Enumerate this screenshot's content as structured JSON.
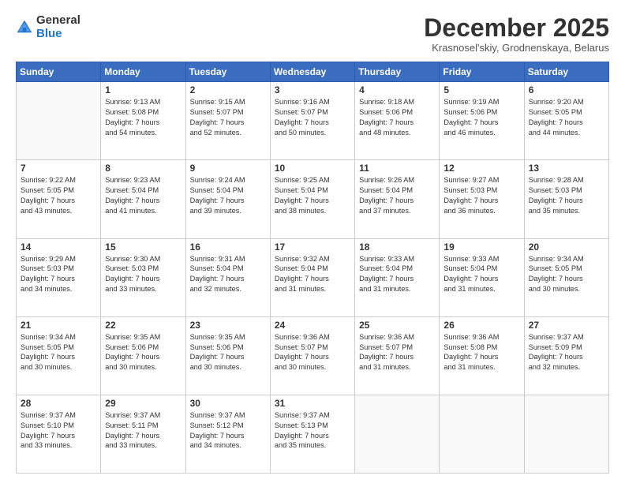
{
  "logo": {
    "general": "General",
    "blue": "Blue"
  },
  "header": {
    "month": "December 2025",
    "location": "Krasnosel'skiy, Grodnenskaya, Belarus"
  },
  "days": [
    "Sunday",
    "Monday",
    "Tuesday",
    "Wednesday",
    "Thursday",
    "Friday",
    "Saturday"
  ],
  "weeks": [
    [
      {
        "day": "",
        "info": ""
      },
      {
        "day": "1",
        "info": "Sunrise: 9:13 AM\nSunset: 5:08 PM\nDaylight: 7 hours\nand 54 minutes."
      },
      {
        "day": "2",
        "info": "Sunrise: 9:15 AM\nSunset: 5:07 PM\nDaylight: 7 hours\nand 52 minutes."
      },
      {
        "day": "3",
        "info": "Sunrise: 9:16 AM\nSunset: 5:07 PM\nDaylight: 7 hours\nand 50 minutes."
      },
      {
        "day": "4",
        "info": "Sunrise: 9:18 AM\nSunset: 5:06 PM\nDaylight: 7 hours\nand 48 minutes."
      },
      {
        "day": "5",
        "info": "Sunrise: 9:19 AM\nSunset: 5:06 PM\nDaylight: 7 hours\nand 46 minutes."
      },
      {
        "day": "6",
        "info": "Sunrise: 9:20 AM\nSunset: 5:05 PM\nDaylight: 7 hours\nand 44 minutes."
      }
    ],
    [
      {
        "day": "7",
        "info": "Sunrise: 9:22 AM\nSunset: 5:05 PM\nDaylight: 7 hours\nand 43 minutes."
      },
      {
        "day": "8",
        "info": "Sunrise: 9:23 AM\nSunset: 5:04 PM\nDaylight: 7 hours\nand 41 minutes."
      },
      {
        "day": "9",
        "info": "Sunrise: 9:24 AM\nSunset: 5:04 PM\nDaylight: 7 hours\nand 39 minutes."
      },
      {
        "day": "10",
        "info": "Sunrise: 9:25 AM\nSunset: 5:04 PM\nDaylight: 7 hours\nand 38 minutes."
      },
      {
        "day": "11",
        "info": "Sunrise: 9:26 AM\nSunset: 5:04 PM\nDaylight: 7 hours\nand 37 minutes."
      },
      {
        "day": "12",
        "info": "Sunrise: 9:27 AM\nSunset: 5:03 PM\nDaylight: 7 hours\nand 36 minutes."
      },
      {
        "day": "13",
        "info": "Sunrise: 9:28 AM\nSunset: 5:03 PM\nDaylight: 7 hours\nand 35 minutes."
      }
    ],
    [
      {
        "day": "14",
        "info": "Sunrise: 9:29 AM\nSunset: 5:03 PM\nDaylight: 7 hours\nand 34 minutes."
      },
      {
        "day": "15",
        "info": "Sunrise: 9:30 AM\nSunset: 5:03 PM\nDaylight: 7 hours\nand 33 minutes."
      },
      {
        "day": "16",
        "info": "Sunrise: 9:31 AM\nSunset: 5:04 PM\nDaylight: 7 hours\nand 32 minutes."
      },
      {
        "day": "17",
        "info": "Sunrise: 9:32 AM\nSunset: 5:04 PM\nDaylight: 7 hours\nand 31 minutes."
      },
      {
        "day": "18",
        "info": "Sunrise: 9:33 AM\nSunset: 5:04 PM\nDaylight: 7 hours\nand 31 minutes."
      },
      {
        "day": "19",
        "info": "Sunrise: 9:33 AM\nSunset: 5:04 PM\nDaylight: 7 hours\nand 31 minutes."
      },
      {
        "day": "20",
        "info": "Sunrise: 9:34 AM\nSunset: 5:05 PM\nDaylight: 7 hours\nand 30 minutes."
      }
    ],
    [
      {
        "day": "21",
        "info": "Sunrise: 9:34 AM\nSunset: 5:05 PM\nDaylight: 7 hours\nand 30 minutes."
      },
      {
        "day": "22",
        "info": "Sunrise: 9:35 AM\nSunset: 5:06 PM\nDaylight: 7 hours\nand 30 minutes."
      },
      {
        "day": "23",
        "info": "Sunrise: 9:35 AM\nSunset: 5:06 PM\nDaylight: 7 hours\nand 30 minutes."
      },
      {
        "day": "24",
        "info": "Sunrise: 9:36 AM\nSunset: 5:07 PM\nDaylight: 7 hours\nand 30 minutes."
      },
      {
        "day": "25",
        "info": "Sunrise: 9:36 AM\nSunset: 5:07 PM\nDaylight: 7 hours\nand 31 minutes."
      },
      {
        "day": "26",
        "info": "Sunrise: 9:36 AM\nSunset: 5:08 PM\nDaylight: 7 hours\nand 31 minutes."
      },
      {
        "day": "27",
        "info": "Sunrise: 9:37 AM\nSunset: 5:09 PM\nDaylight: 7 hours\nand 32 minutes."
      }
    ],
    [
      {
        "day": "28",
        "info": "Sunrise: 9:37 AM\nSunset: 5:10 PM\nDaylight: 7 hours\nand 33 minutes."
      },
      {
        "day": "29",
        "info": "Sunrise: 9:37 AM\nSunset: 5:11 PM\nDaylight: 7 hours\nand 33 minutes."
      },
      {
        "day": "30",
        "info": "Sunrise: 9:37 AM\nSunset: 5:12 PM\nDaylight: 7 hours\nand 34 minutes."
      },
      {
        "day": "31",
        "info": "Sunrise: 9:37 AM\nSunset: 5:13 PM\nDaylight: 7 hours\nand 35 minutes."
      },
      {
        "day": "",
        "info": ""
      },
      {
        "day": "",
        "info": ""
      },
      {
        "day": "",
        "info": ""
      }
    ]
  ]
}
